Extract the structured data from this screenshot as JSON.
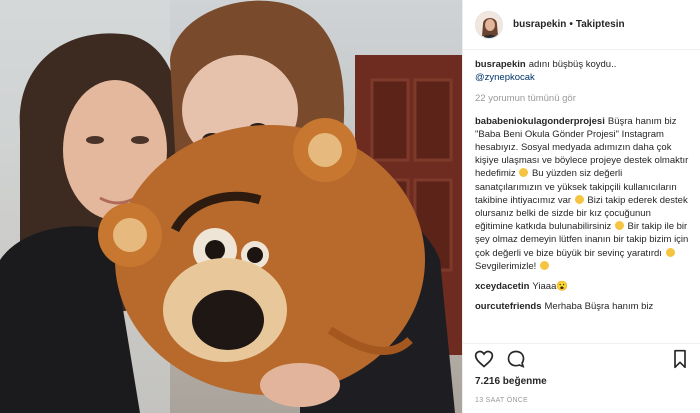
{
  "post": {
    "author": "busrapekin",
    "follow_status": "Takiptesin",
    "separator": "•",
    "caption_username": "busrapekin",
    "caption_text": "adını büşbüş koydu..",
    "caption_mention": "@zynepkocak",
    "load_more": "22 yorumun tümünü gör",
    "comments": [
      {
        "username": "bababeniokulagonderprojesi",
        "parts": [
          "Büşra hanım biz \"Baba Beni Okula Gönder Projesi\" Instagram hesabıyız. Sosyal medyada adımızın daha çok kişiye ulaşması ve böylece projeye destek olmaktır hedefimiz",
          "Bu yüzden siz değerli sanatçılarımızın ve yüksek takipçili kullanıcıların takibine ihtiyacımız var",
          "Bizi takip ederek destek olursanız belki de sizde bir kız çocuğunun eğitimine katkıda bulunabilirsiniz",
          "Bir takip ile bir şey olmaz demeyin lütfen inanın bir takip bizim için çok değerli ve bize büyük bir sevinç yaratırdı",
          "Sevgilerimizle!"
        ]
      },
      {
        "username": "xceydacetin",
        "text": "Yiaaa😮"
      },
      {
        "username": "ourcutefriends",
        "text": "Merhaba Büşra hanım biz"
      }
    ],
    "likes": "7.216 beğenme",
    "time_ago": "13 SAAT ÖNCE",
    "colors": {
      "link": "#003569",
      "muted": "#999999",
      "text": "#262626"
    },
    "icons": [
      "heart-icon",
      "comment-icon",
      "bookmark-icon"
    ]
  }
}
